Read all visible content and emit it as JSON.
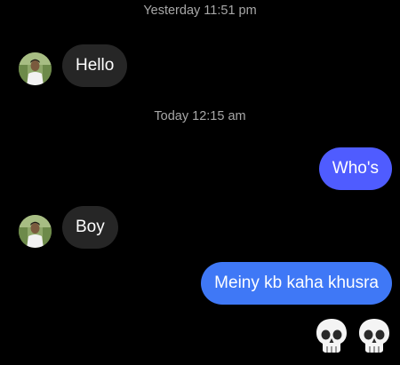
{
  "thread": {
    "timestamp_1": "Yesterday 11:51 pm",
    "timestamp_2": "Today 12:15 am",
    "messages": [
      {
        "sender": "other",
        "text": "Hello"
      },
      {
        "sender": "me",
        "text": "Who's"
      },
      {
        "sender": "other",
        "text": "Boy"
      },
      {
        "sender": "me",
        "text": "Meiny kb kaha khusra"
      }
    ],
    "reaction_emojis": [
      "skull-emoji",
      "skull-emoji"
    ]
  },
  "colors": {
    "background": "#000000",
    "incoming_bubble": "#262626",
    "outgoing_bubble_top": "#4f5cff",
    "outgoing_bubble_bottom": "#3f78f6",
    "timestamp_text": "#a8a8a8"
  },
  "icons": {
    "avatar": "contact-avatar-photo",
    "emoji": "skull-emoji"
  }
}
